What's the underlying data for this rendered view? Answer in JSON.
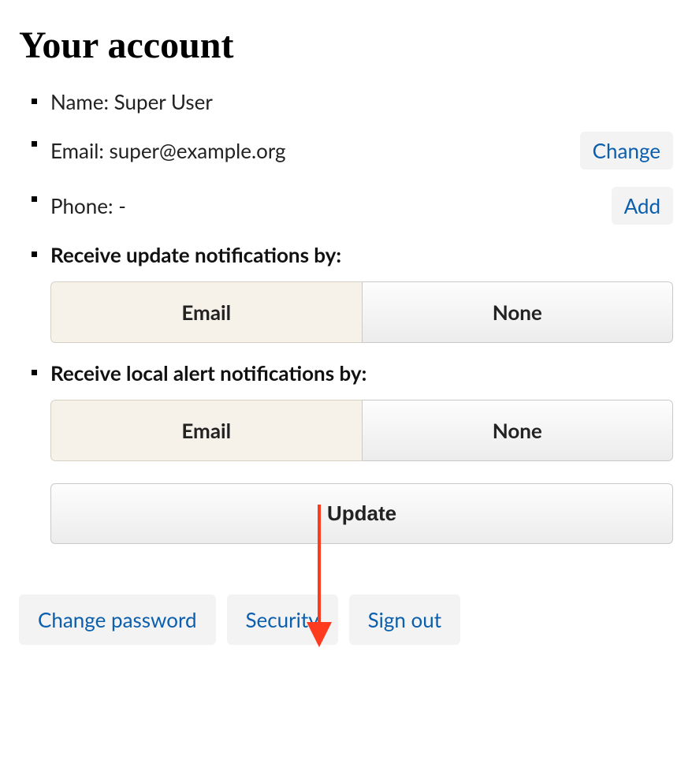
{
  "page": {
    "title": "Your account"
  },
  "account": {
    "name_label": "Name:",
    "name_value": "Super User",
    "email_label": "Email:",
    "email_value": "super@example.org",
    "email_change_label": "Change",
    "phone_label": "Phone:",
    "phone_value": "-",
    "phone_add_label": "Add"
  },
  "notifications": {
    "update_header": "Receive update notifications by:",
    "alert_header": "Receive local alert notifications by:",
    "option_email": "Email",
    "option_none": "None",
    "update_button": "Update"
  },
  "bottom_links": {
    "change_password": "Change password",
    "security": "Security",
    "sign_out": "Sign out"
  },
  "annotation": {
    "arrow_target": "security-link"
  }
}
